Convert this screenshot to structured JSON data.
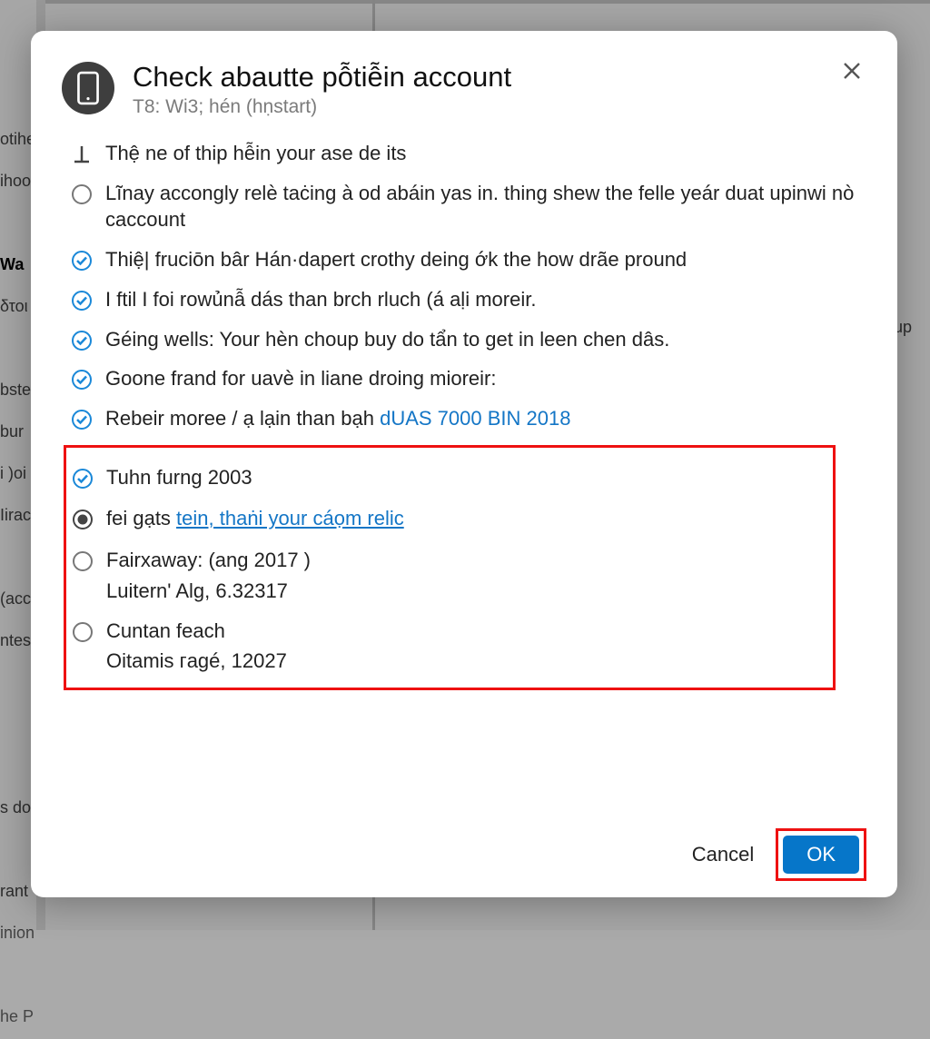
{
  "bg": {
    "sidebar_items": [
      "",
      "",
      "otihe",
      "ihoo",
      "",
      "Wa",
      "δτοι",
      "",
      "bste",
      "bur",
      "i )oi",
      "Iirac",
      "",
      "(acc",
      "ntes",
      "",
      "",
      "",
      "s do",
      "",
      "rant",
      "inion",
      "",
      "he P"
    ],
    "right_snippet": "up"
  },
  "dialog": {
    "title": "Check abautte pỗtiễin account",
    "subtitle": "T8: Wi3; hén (hṇstart)"
  },
  "items": [
    {
      "bullet": "line",
      "text": "Thệ ne of thip hễin your ase de its"
    },
    {
      "bullet": "radio",
      "text": "Lĩnay accongly relè taċing à od abáin yas in. thing shew the felle yeár duat upinwi nò caccount"
    },
    {
      "bullet": "check",
      "text": "Thiệ| fruciōn bâr Hán·dapert crothy deing ớk the how drãe pround"
    },
    {
      "bullet": "check",
      "text": "I ftil I foi rowủnẫ dás than brch rluch (á aḷi moreir."
    },
    {
      "bullet": "check",
      "text": "Géing wells: Your hèn choup buy do tẩn to get in leen chen dâs."
    },
    {
      "bullet": "check",
      "text": "Goone frand for uavè in liane droing mioreir:"
    },
    {
      "bullet": "check",
      "text": "Rebeir moree / ạ lạin than bạh ",
      "link_plain": "dUAS 7000 BIN 2018"
    }
  ],
  "boxed": [
    {
      "bullet": "check",
      "text": "Tuhn furng 2003"
    },
    {
      "bullet": "radio-filled",
      "text": "fei gạts ",
      "link": "tein, thaṅi your cáọm relic"
    },
    {
      "bullet": "radio",
      "text": "Fairxaway: (ang 2017 )",
      "sub": "Luitern' Alg, 6.32317"
    },
    {
      "bullet": "radio",
      "text": "Cuntan feach",
      "sub": "Oitamis ᴦagé, 12027"
    }
  ],
  "footer": {
    "cancel": "Cancel",
    "ok": "OK"
  }
}
